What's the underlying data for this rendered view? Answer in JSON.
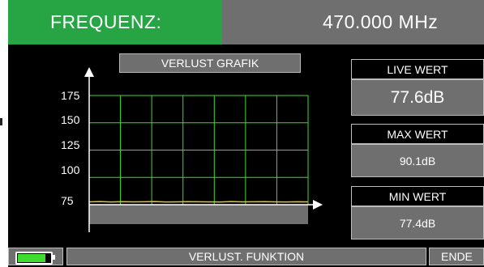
{
  "header": {
    "label": "FREQUENZ:",
    "value": "470.000 MHz"
  },
  "graph": {
    "title": "VERLUST GRAFIK",
    "ticks": [
      "175",
      "150",
      "125",
      "100",
      "75"
    ]
  },
  "chart_data": {
    "type": "line",
    "title": "VERLUST GRAFIK",
    "xlabel": "",
    "ylabel": "",
    "ylim": [
      75,
      175
    ],
    "yticks": [
      75,
      100,
      125,
      150,
      175
    ],
    "grid": true,
    "series": [
      {
        "values": [
          77.6,
          77.9,
          77.5,
          77.8,
          77.6,
          77.7,
          77.9,
          77.5,
          77.6,
          77.8,
          77.7,
          77.6,
          77.5,
          77.9,
          77.6,
          77.7,
          77.8,
          77.6,
          77.5,
          77.7,
          77.6
        ]
      }
    ]
  },
  "live": {
    "label": "LIVE WERT",
    "value": "77.6dB"
  },
  "max": {
    "label": "MAX WERT",
    "value": "90.1dB"
  },
  "min": {
    "label": "MIN WERT",
    "value": "77.4dB"
  },
  "footer": {
    "function": "VERLUST. FUNKTION",
    "end": "ENDE",
    "battery_level": 0.9
  },
  "colors": {
    "accent": "#27a544",
    "grid": "#3ddc2e",
    "trace": "#e6c622",
    "panel": "#6f6f6f"
  }
}
